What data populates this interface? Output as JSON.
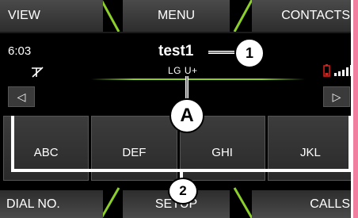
{
  "top_bar": {
    "view_label": "VIEW",
    "menu_label": "MENU",
    "contacts_label": "CONTACTS"
  },
  "status": {
    "time": "6:03",
    "no_signal_icon": "no-signal-icon",
    "battery_icon": "battery-low-icon",
    "signal_icon": "signal-strength-icon"
  },
  "call": {
    "contact_name": "test1",
    "network": "LG U+"
  },
  "navigation": {
    "prev_icon": "◁",
    "next_icon": "▷"
  },
  "keypad": {
    "keys": [
      "ABC",
      "DEF",
      "GHI",
      "JKL"
    ]
  },
  "callouts": {
    "one": "1",
    "a": "A",
    "two": "2"
  },
  "bottom_bar": {
    "dial_label": "DIAL NO.",
    "setup_label": "SETUP",
    "calls_label": "CALLS"
  },
  "colors": {
    "accent_green": "#8ccf2a",
    "battery_red": "#e0201a",
    "strip_pink": "#f07fa0"
  }
}
